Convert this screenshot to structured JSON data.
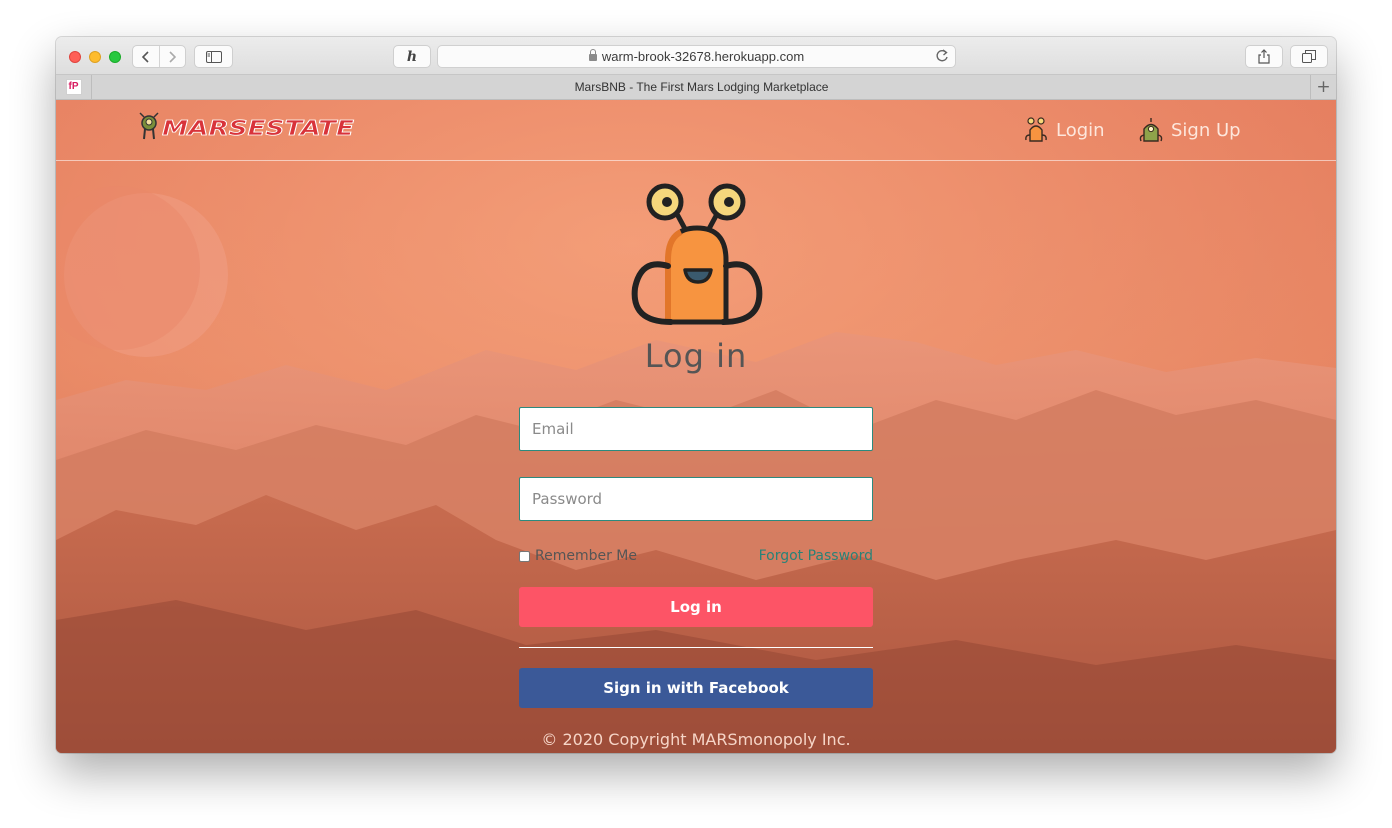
{
  "browser": {
    "url": "warm-brook-32678.herokuapp.com",
    "tab_title": "MarsBNB - The First Mars Lodging Marketplace",
    "pinned_tab_label": "fP",
    "new_tab_glyph": "+",
    "extension_glyph": "h"
  },
  "site": {
    "logo_text": "MARSESTATE",
    "nav": {
      "login_label": "Login",
      "signup_label": "Sign Up"
    }
  },
  "login_form": {
    "title": "Log in",
    "email_placeholder": "Email",
    "password_placeholder": "Password",
    "remember_label": "Remember Me",
    "forgot_label": "Forgot Password",
    "submit_label": "Log in",
    "facebook_label": "Sign in with Facebook"
  },
  "footer": {
    "copyright": "© 2020 Copyright MARSmonopoly Inc."
  },
  "colors": {
    "login_button": "#fd5466",
    "facebook_button": "#3b5998",
    "link_teal": "#2a8277",
    "mascot_orange": "#f79440"
  }
}
